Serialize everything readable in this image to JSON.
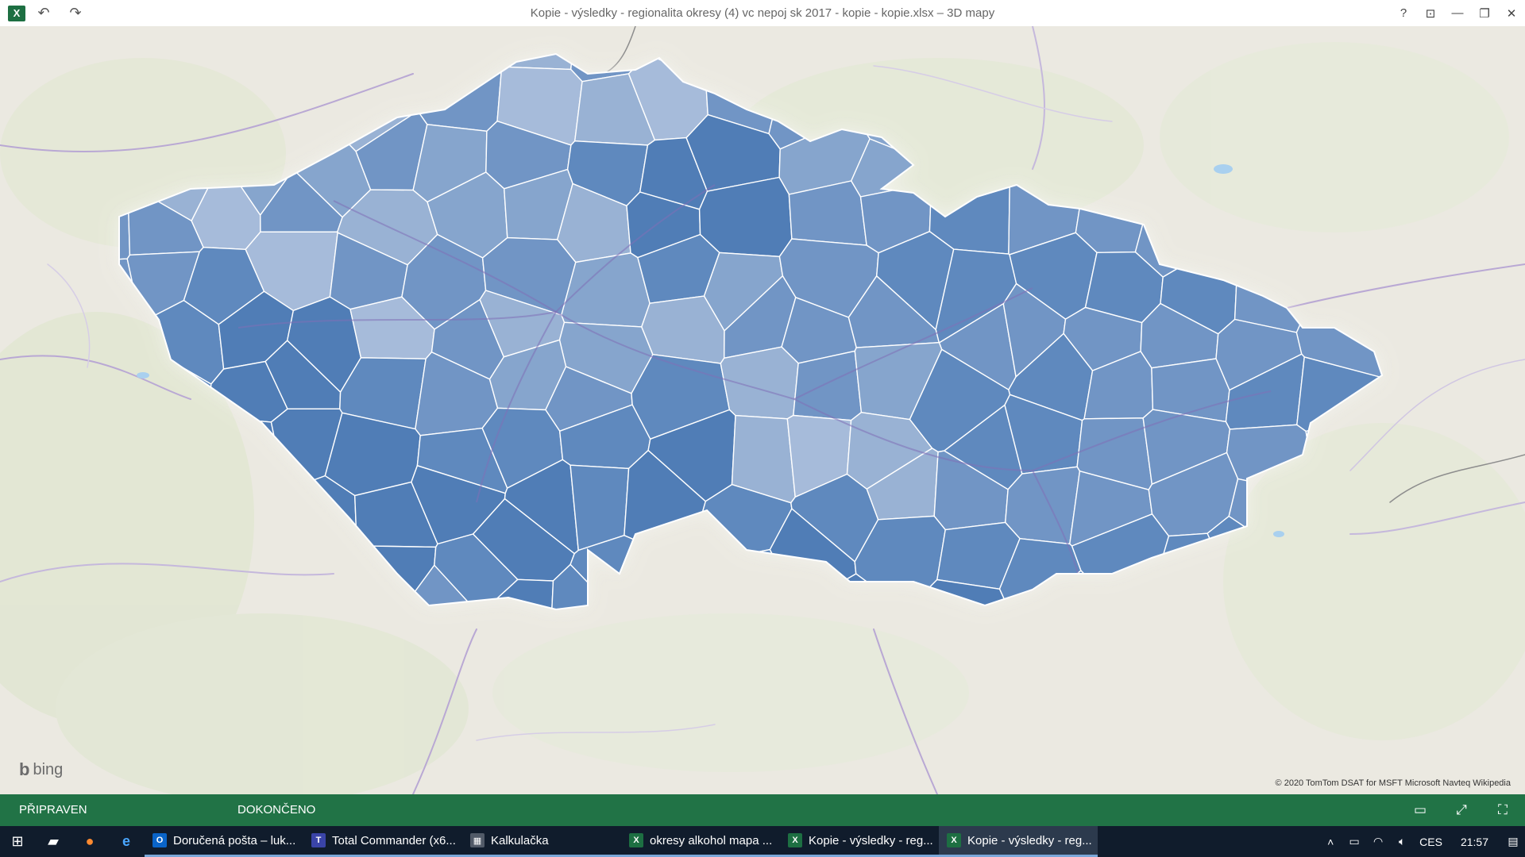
{
  "window": {
    "app_icon": "excel-icon",
    "title": "Kopie - výsledky - regionalita okresy (4) vc nepoj sk 2017 - kopie - kopie.xlsx – 3D mapy",
    "undo_icon": "undo-icon",
    "redo_icon": "redo-icon",
    "help_label": "?"
  },
  "map": {
    "provider_label": "bing",
    "attribution": "© 2020 TomTom  DSAT for MSFT  Microsoft  Navteq  Wikipedia",
    "fill_colors": [
      "#4b79b4",
      "#5b87bd",
      "#6f94c4",
      "#86a5cd",
      "#9ab3d5",
      "#a8bddb"
    ],
    "border_color": "#ffffff",
    "land_color": "#eceae3"
  },
  "status": {
    "ready": "PŘIPRAVEN",
    "done": "DOKONČENO"
  },
  "taskbar": {
    "items": [
      {
        "label": "Doručená pošta – luk...",
        "icon": "outlook-icon"
      },
      {
        "label": "Total Commander (x6...",
        "icon": "total-commander-icon"
      },
      {
        "label": "Kalkulačka",
        "icon": "calculator-icon"
      },
      {
        "label": "okresy alkohol mapa ...",
        "icon": "excel-icon"
      },
      {
        "label": "Kopie - výsledky - reg...",
        "icon": "excel-icon"
      },
      {
        "label": "Kopie - výsledky - reg...",
        "icon": "excel-icon"
      }
    ],
    "language": "CES",
    "time": "21:57"
  }
}
